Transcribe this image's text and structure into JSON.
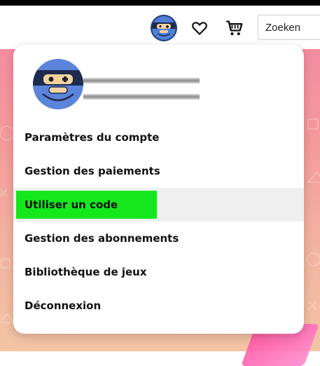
{
  "header": {
    "search": {
      "value": "",
      "placeholder": "Zoeken"
    },
    "icons": {
      "avatar": "robot-avatar-icon",
      "wishlist": "heart-icon",
      "cart": "cart-icon"
    }
  },
  "menu": {
    "items": [
      {
        "label": "Paramètres du compte"
      },
      {
        "label": "Gestion des paiements"
      },
      {
        "label": "Utiliser un code",
        "highlighted": true
      },
      {
        "label": "Gestion des abonnements"
      },
      {
        "label": "Bibliothèque de jeux"
      },
      {
        "label": "Déconnexion"
      }
    ]
  },
  "colors": {
    "highlight": "#14e81d",
    "avatar_bg": "#5b84db",
    "background_pink": "#f58ca0"
  }
}
